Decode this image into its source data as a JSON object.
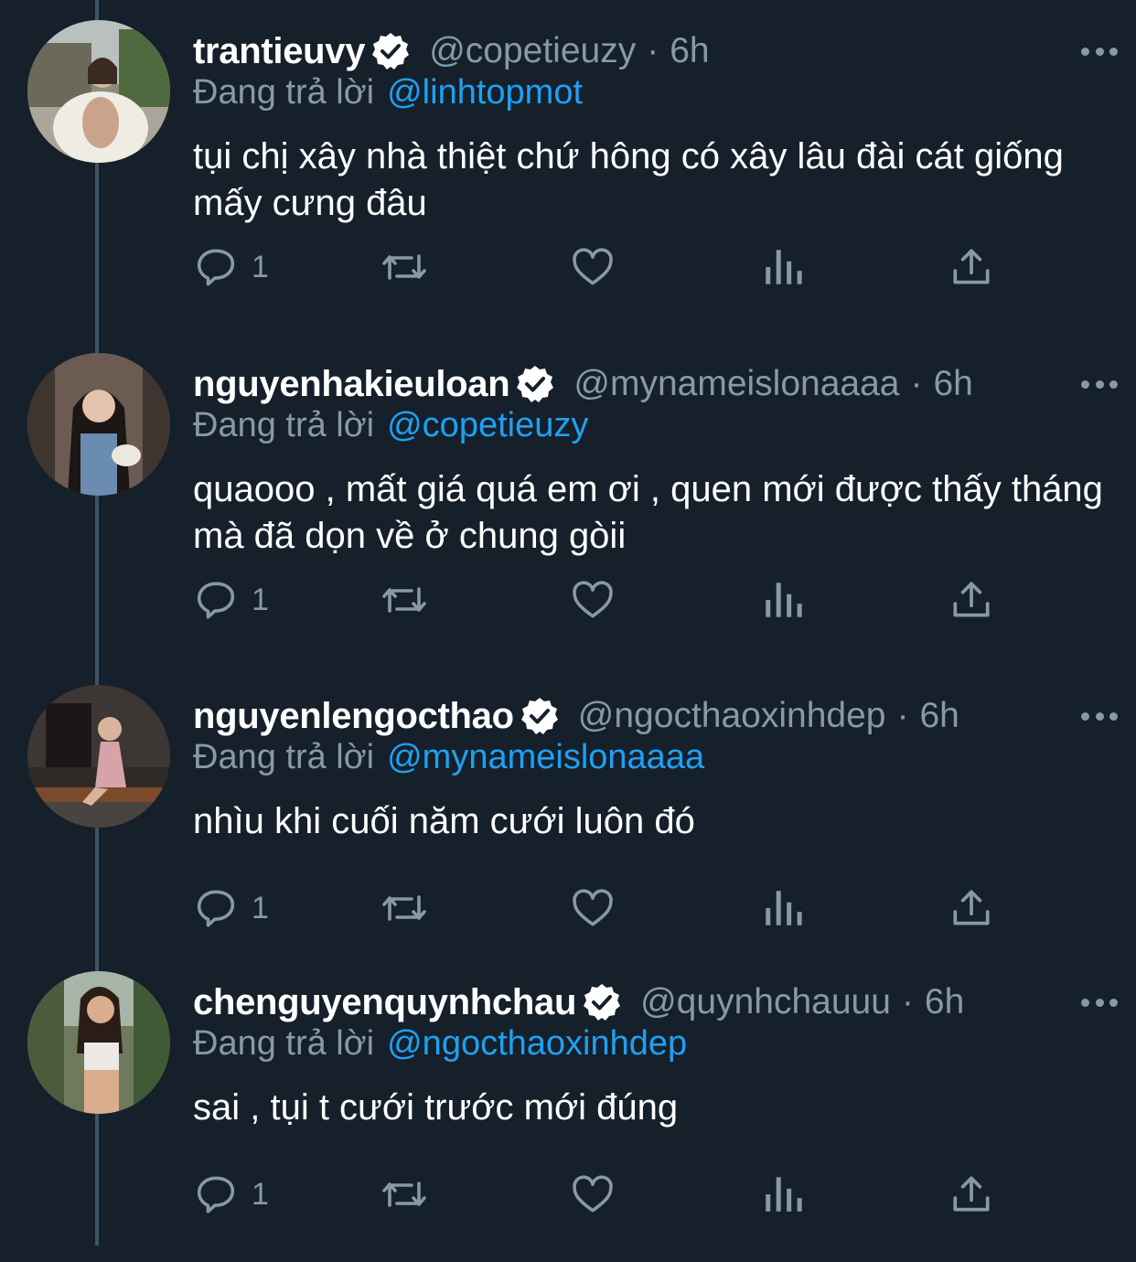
{
  "colors": {
    "background": "#15202b",
    "primary_text": "#ffffff",
    "secondary_text": "#8899a6",
    "link": "#1da1f2",
    "thread_line": "#3d5466"
  },
  "tweets": [
    {
      "display_name": "trantieuvy",
      "handle": "@copetieuzy",
      "separator": "·",
      "time": "6h",
      "replying_label": "Đang trả lời",
      "replying_to": "@linhtopmot",
      "text": "tụi chị xây nhà thiệt chứ hông có xây lâu đài cát giống mấy cưng đâu",
      "reply_count": "1"
    },
    {
      "display_name": "nguyenhakieuloan",
      "handle": "@mynameislonaaaa",
      "separator": "·",
      "time": "6h",
      "replying_label": "Đang trả lời",
      "replying_to": "@copetieuzy",
      "text": "quaooo , mất giá quá em ơi , quen mới được thấy tháng mà đã dọn về ở chung gòii",
      "reply_count": "1"
    },
    {
      "display_name": "nguyenlengocthao",
      "handle": "@ngocthaoxinhdep",
      "separator": "·",
      "time": "6h",
      "replying_label": "Đang trả lời",
      "replying_to": "@mynameislonaaaa",
      "text": "nhìu khi cuối năm cưới luôn đó",
      "reply_count": "1"
    },
    {
      "display_name": "chenguyenquynhchau",
      "handle": "@quynhchauuu",
      "separator": "·",
      "time": "6h",
      "replying_label": "Đang trả lời",
      "replying_to": "@ngocthaoxinhdep",
      "text": "sai , tụi t cưới trước mới đúng",
      "reply_count": "1"
    }
  ],
  "icons": {
    "reply": "reply-icon",
    "retweet": "retweet-icon",
    "like": "heart-icon",
    "analytics": "analytics-icon",
    "share": "share-icon",
    "verified": "verified-badge-icon",
    "more": "more-icon"
  }
}
